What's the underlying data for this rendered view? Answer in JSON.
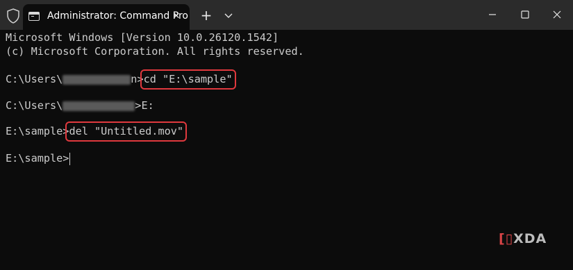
{
  "window": {
    "tab_title": "Administrator: Command Pro",
    "tab_close": "✕",
    "new_tab": "+",
    "controls": [
      "minimize",
      "maximize",
      "close"
    ]
  },
  "terminal": {
    "lines": [
      "Microsoft Windows [Version 10.0.26120.1542]",
      "(c) Microsoft Corporation. All rights reserved."
    ],
    "cmd1": {
      "prompt_start": "C:\\Users\\",
      "prompt_tail": "n>",
      "command": "cd \"E:\\sample\""
    },
    "cmd2": {
      "prompt_start": "C:\\Users\\",
      "prompt_tail": ">E:"
    },
    "cmd3": {
      "prompt": "E:\\sample>",
      "command": "del \"Untitled.mov\""
    },
    "cmd4": {
      "prompt": "E:\\sample>"
    }
  },
  "colors": {
    "background": "#0c0c0c",
    "titlebar": "#2b2b2b",
    "text": "#cccccc",
    "highlight_box": "#e0393e"
  },
  "watermark": {
    "text": "XDA"
  }
}
